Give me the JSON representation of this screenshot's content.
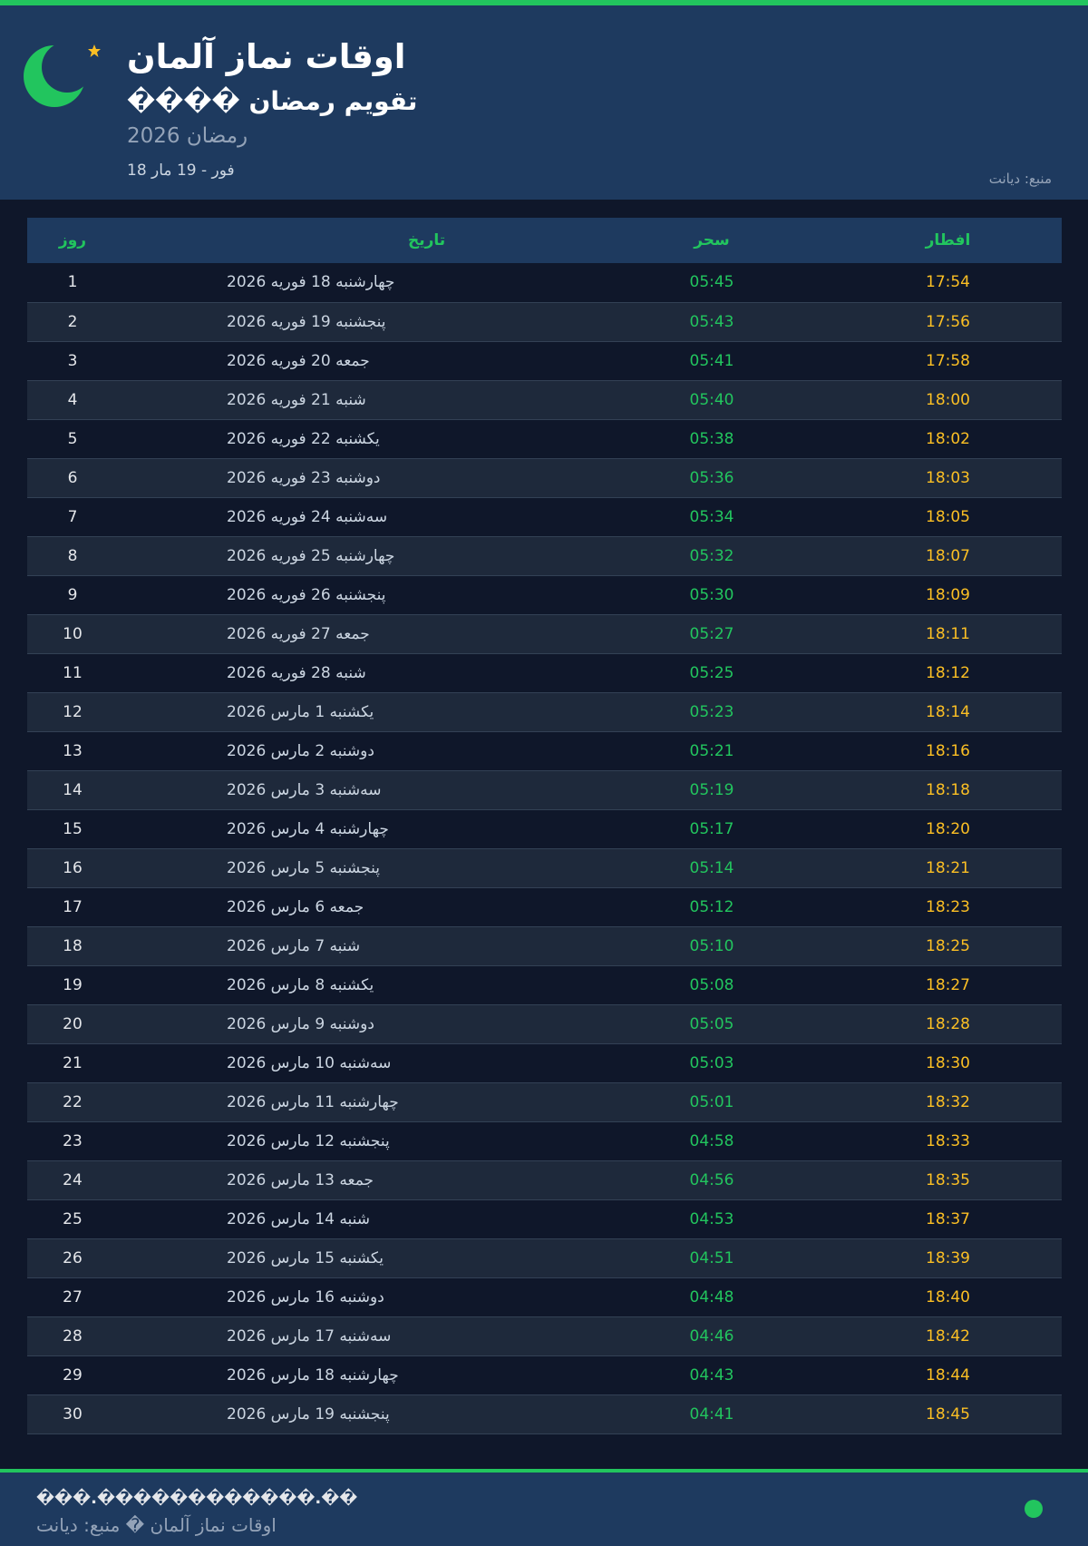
{
  "header": {
    "title": "اوقات نماز آلمان",
    "subtitle": "���� تقويم رمضان",
    "year_label": "رمضان 2026",
    "date_range": "18 فور - 19 مار",
    "source": "منبع: دیانت"
  },
  "table": {
    "headers": {
      "day": "روز",
      "date": "تاریخ",
      "sahar": "سحر",
      "iftar": "افطار"
    },
    "rows": [
      {
        "day": "1",
        "date": "چهارشنبه 18 فوریه 2026",
        "sahar": "05:45",
        "iftar": "17:54"
      },
      {
        "day": "2",
        "date": "پنجشنبه 19 فوریه 2026",
        "sahar": "05:43",
        "iftar": "17:56"
      },
      {
        "day": "3",
        "date": "جمعه 20 فوریه 2026",
        "sahar": "05:41",
        "iftar": "17:58"
      },
      {
        "day": "4",
        "date": "شنبه 21 فوریه 2026",
        "sahar": "05:40",
        "iftar": "18:00"
      },
      {
        "day": "5",
        "date": "یکشنبه 22 فوریه 2026",
        "sahar": "05:38",
        "iftar": "18:02"
      },
      {
        "day": "6",
        "date": "دوشنبه 23 فوریه 2026",
        "sahar": "05:36",
        "iftar": "18:03"
      },
      {
        "day": "7",
        "date": "سه‌شنبه 24 فوریه 2026",
        "sahar": "05:34",
        "iftar": "18:05"
      },
      {
        "day": "8",
        "date": "چهارشنبه 25 فوریه 2026",
        "sahar": "05:32",
        "iftar": "18:07"
      },
      {
        "day": "9",
        "date": "پنجشنبه 26 فوریه 2026",
        "sahar": "05:30",
        "iftar": "18:09"
      },
      {
        "day": "10",
        "date": "جمعه 27 فوریه 2026",
        "sahar": "05:27",
        "iftar": "18:11"
      },
      {
        "day": "11",
        "date": "شنبه 28 فوریه 2026",
        "sahar": "05:25",
        "iftar": "18:12"
      },
      {
        "day": "12",
        "date": "یکشنبه 1 مارس 2026",
        "sahar": "05:23",
        "iftar": "18:14"
      },
      {
        "day": "13",
        "date": "دوشنبه 2 مارس 2026",
        "sahar": "05:21",
        "iftar": "18:16"
      },
      {
        "day": "14",
        "date": "سه‌شنبه 3 مارس 2026",
        "sahar": "05:19",
        "iftar": "18:18"
      },
      {
        "day": "15",
        "date": "چهارشنبه 4 مارس 2026",
        "sahar": "05:17",
        "iftar": "18:20"
      },
      {
        "day": "16",
        "date": "پنجشنبه 5 مارس 2026",
        "sahar": "05:14",
        "iftar": "18:21"
      },
      {
        "day": "17",
        "date": "جمعه 6 مارس 2026",
        "sahar": "05:12",
        "iftar": "18:23"
      },
      {
        "day": "18",
        "date": "شنبه 7 مارس 2026",
        "sahar": "05:10",
        "iftar": "18:25"
      },
      {
        "day": "19",
        "date": "یکشنبه 8 مارس 2026",
        "sahar": "05:08",
        "iftar": "18:27"
      },
      {
        "day": "20",
        "date": "دوشنبه 9 مارس 2026",
        "sahar": "05:05",
        "iftar": "18:28"
      },
      {
        "day": "21",
        "date": "سه‌شنبه 10 مارس 2026",
        "sahar": "05:03",
        "iftar": "18:30"
      },
      {
        "day": "22",
        "date": "چهارشنبه 11 مارس 2026",
        "sahar": "05:01",
        "iftar": "18:32"
      },
      {
        "day": "23",
        "date": "پنجشنبه 12 مارس 2026",
        "sahar": "04:58",
        "iftar": "18:33"
      },
      {
        "day": "24",
        "date": "جمعه 13 مارس 2026",
        "sahar": "04:56",
        "iftar": "18:35"
      },
      {
        "day": "25",
        "date": "شنبه 14 مارس 2026",
        "sahar": "04:53",
        "iftar": "18:37"
      },
      {
        "day": "26",
        "date": "یکشنبه 15 مارس 2026",
        "sahar": "04:51",
        "iftar": "18:39"
      },
      {
        "day": "27",
        "date": "دوشنبه 16 مارس 2026",
        "sahar": "04:48",
        "iftar": "18:40"
      },
      {
        "day": "28",
        "date": "سه‌شنبه 17 مارس 2026",
        "sahar": "04:46",
        "iftar": "18:42"
      },
      {
        "day": "29",
        "date": "چهارشنبه 18 مارس 2026",
        "sahar": "04:43",
        "iftar": "18:44"
      },
      {
        "day": "30",
        "date": "پنجشنبه 19 مارس 2026",
        "sahar": "04:41",
        "iftar": "18:45"
      }
    ]
  },
  "footer": {
    "url": "���.������������.��",
    "text": "اوقات نماز آلمان � منبع: دیانت"
  },
  "colors": {
    "accent": "#22c55e",
    "iftar": "#fbbf24",
    "header_bg": "#1e3a5f",
    "page_bg": "#0f172a"
  },
  "icons": {
    "moon": "crescent-moon-icon",
    "star": "star-icon",
    "status": "status-dot"
  }
}
